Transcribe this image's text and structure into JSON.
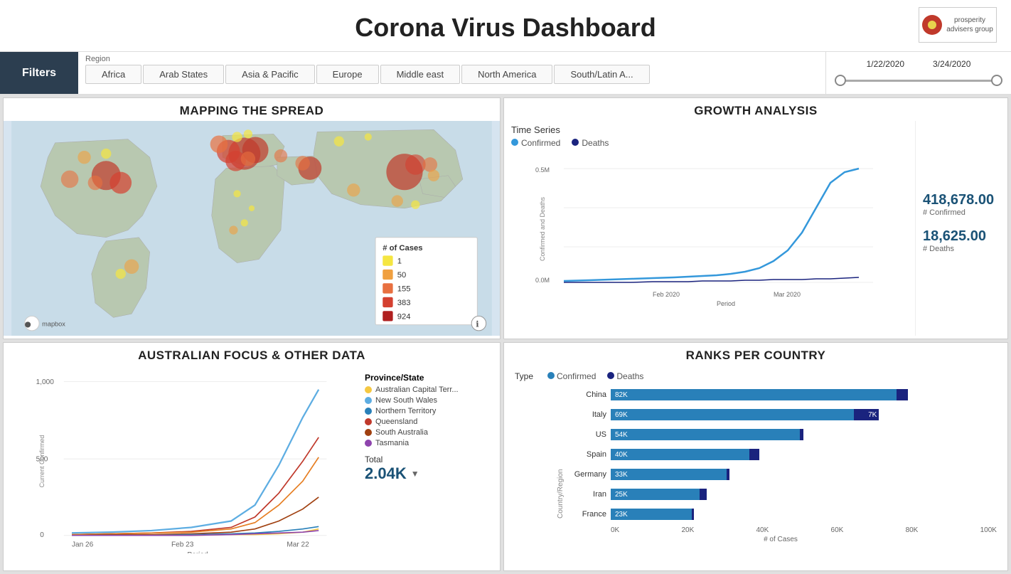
{
  "header": {
    "title": "Corona Virus Dashboard",
    "logo_text": "prosperity\nadvvisers group"
  },
  "filters": {
    "label": "Filters",
    "region_label": "Region",
    "regions": [
      "Africa",
      "Arab States",
      "Asia & Pacific",
      "Europe",
      "Middle east",
      "North America",
      "South/Latin A..."
    ],
    "date_start": "1/22/2020",
    "date_end": "3/24/2020"
  },
  "mapping": {
    "title": "MAPPING THE SPREAD",
    "legend_title": "# of Cases",
    "legend_items": [
      {
        "value": "1",
        "color": "#f5e642"
      },
      {
        "value": "50",
        "color": "#f0a040"
      },
      {
        "value": "155",
        "color": "#e87040"
      },
      {
        "value": "383",
        "color": "#d44030"
      },
      {
        "value": "924",
        "color": "#b02020"
      }
    ]
  },
  "growth": {
    "title": "GROWTH ANALYSIS",
    "time_series_label": "Time Series",
    "legend": [
      {
        "label": "Confirmed",
        "color": "#3498db"
      },
      {
        "label": "Deaths",
        "color": "#1a237e"
      }
    ],
    "confirmed_value": "418,678.00",
    "confirmed_label": "# Confirmed",
    "deaths_value": "18,625.00",
    "deaths_label": "# Deaths",
    "x_labels": [
      "Feb 2020",
      "Mar 2020"
    ],
    "y_labels": [
      "0.5M",
      "0.0M"
    ],
    "y_axis_label": "Confirmed and Deaths",
    "x_axis_label": "Period"
  },
  "australian": {
    "title": "AUSTRALIAN FOCUS & OTHER DATA",
    "y_label": "Current Confirmed",
    "x_label": "Period",
    "x_ticks": [
      "Jan 26",
      "Feb 23",
      "Mar 22"
    ],
    "y_ticks": [
      "1,000",
      "500",
      "0"
    ],
    "legend_title": "Province/State",
    "provinces": [
      {
        "name": "Australian Capital Terr...",
        "color": "#f5c842"
      },
      {
        "name": "New South Wales",
        "color": "#5dade2"
      },
      {
        "name": "Northern Territory",
        "color": "#2980b9"
      },
      {
        "name": "Queensland",
        "color": "#c0392b"
      },
      {
        "name": "South Australia",
        "color": "#a04010"
      },
      {
        "name": "Tasmania",
        "color": "#8e44ad"
      }
    ],
    "total_label": "Total",
    "total_value": "2.04K"
  },
  "ranks": {
    "title": "RANKS PER COUNTRY",
    "type_label": "Type",
    "legend": [
      {
        "label": "Confirmed",
        "color": "#2980b9"
      },
      {
        "label": "Deaths",
        "color": "#1a237e"
      }
    ],
    "y_axis_label": "Country/Region",
    "x_axis_label": "# of Cases",
    "x_ticks": [
      "0K",
      "20K",
      "40K",
      "60K",
      "80K",
      "100K"
    ],
    "countries": [
      {
        "name": "China",
        "confirmed": 82,
        "deaths": 3.3,
        "confirmed_label": "82K",
        "deaths_label": ""
      },
      {
        "name": "Italy",
        "confirmed": 69,
        "deaths": 7,
        "confirmed_label": "69K",
        "deaths_label": "7K"
      },
      {
        "name": "US",
        "confirmed": 54,
        "deaths": 1.2,
        "confirmed_label": "54K",
        "deaths_label": ""
      },
      {
        "name": "Spain",
        "confirmed": 40,
        "deaths": 2.8,
        "confirmed_label": "40K",
        "deaths_label": ""
      },
      {
        "name": "Germany",
        "confirmed": 33,
        "deaths": 0.8,
        "confirmed_label": "33K",
        "deaths_label": ""
      },
      {
        "name": "Iran",
        "confirmed": 25,
        "deaths": 2,
        "confirmed_label": "25K",
        "deaths_label": ""
      },
      {
        "name": "France",
        "confirmed": 23,
        "deaths": 0.7,
        "confirmed_label": "23K",
        "deaths_label": ""
      }
    ]
  }
}
